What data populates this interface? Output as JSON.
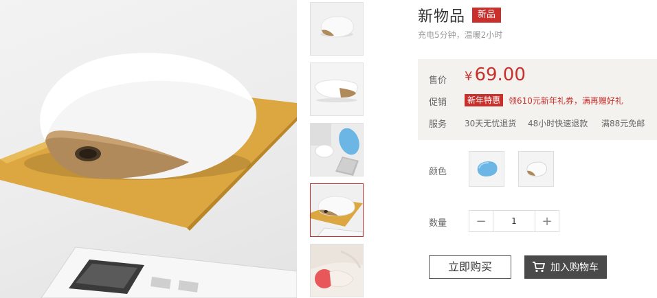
{
  "product": {
    "title": "新物品",
    "badge": "新品",
    "subtitle": "充电5分钟，温暖2小时"
  },
  "price_box": {
    "price_label": "售价",
    "currency": "¥",
    "price": "69.00",
    "promo_label": "促销",
    "promo_badge": "新年特惠",
    "promo_text": "领610元新年礼券，满再赠好礼",
    "service_label": "服务",
    "services": [
      "30天无忧退货",
      "48小时快速退款",
      "满88元免邮"
    ]
  },
  "options": {
    "color_label": "颜色",
    "colors": [
      "blue",
      "white"
    ],
    "quantity_label": "数量",
    "quantity": "1",
    "minus": "−",
    "plus": "+"
  },
  "actions": {
    "buy_now": "立即购买",
    "add_to_cart": "加入购物车"
  },
  "colors": {
    "accent": "#c9302c",
    "price_bg": "#f3f2ef",
    "cart_button": "#4a4a4a",
    "pad_yellow": "#e0ac3c",
    "gold": "#b08a5a",
    "blue": "#6cb6e6"
  },
  "thumbnails": [
    "front-view",
    "side-view",
    "lifestyle-view",
    "pad-view",
    "hand-view"
  ],
  "active_thumbnail": 3
}
